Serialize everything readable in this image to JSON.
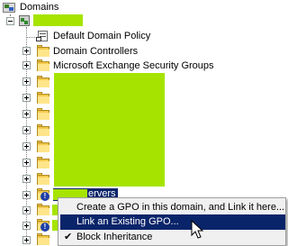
{
  "tree": {
    "root": {
      "label": "Domains"
    },
    "domain_item": {
      "label": ""
    },
    "items": [
      {
        "label": "Default Domain Policy"
      },
      {
        "label": "Domain Controllers"
      },
      {
        "label": "Microsoft Exchange Security Groups"
      }
    ],
    "highlighted_item": {
      "label": "ervers"
    }
  },
  "context_menu": {
    "items": [
      {
        "label": "Create a GPO in this domain, and Link it here..."
      },
      {
        "label": "Link an Existing GPO..."
      },
      {
        "label": "Block Inheritance",
        "checked": true
      }
    ]
  },
  "colors": {
    "redaction": "#a6e400",
    "menu_highlight": "#0a246a",
    "selection": "#0a246a"
  }
}
